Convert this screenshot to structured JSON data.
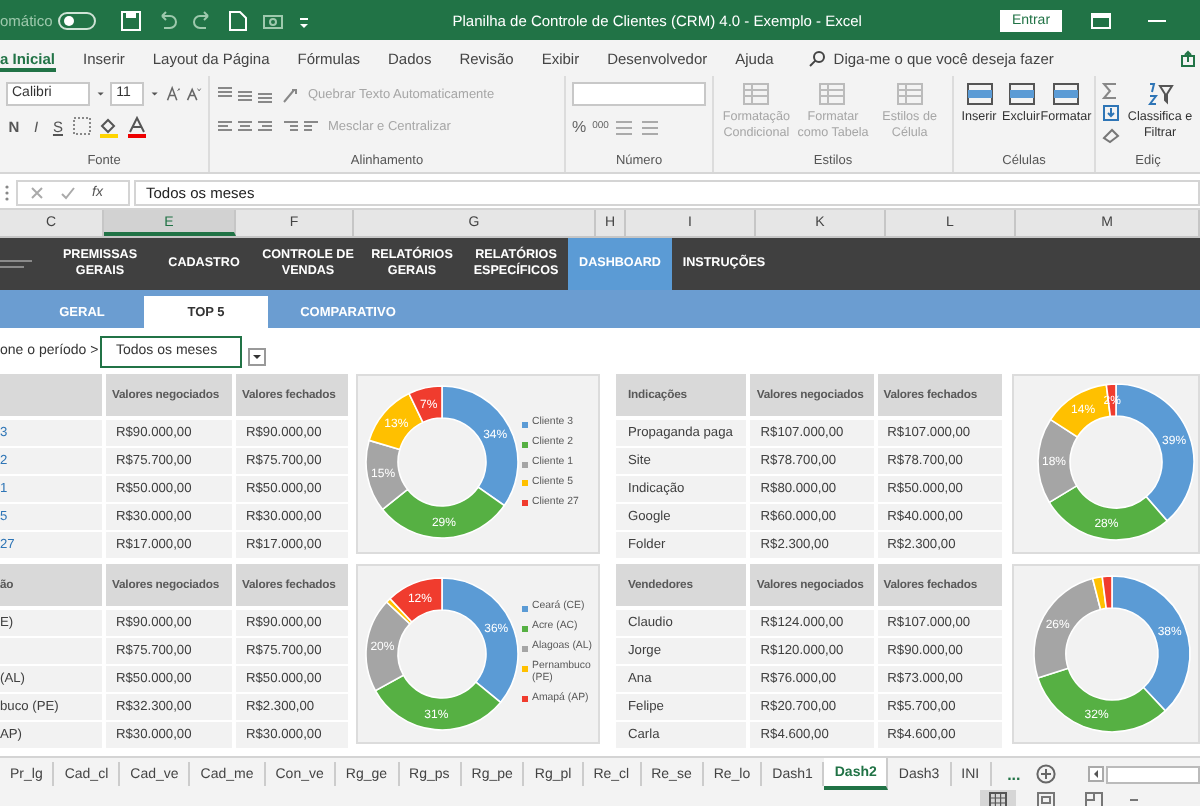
{
  "title_bar": {
    "autosave_label": "omático",
    "autosave_on": false,
    "title": "Planilha de Controle de Clientes (CRM) 4.0 - Exemplo  -  Excel",
    "sign_in": "Entrar"
  },
  "ribbon_tabs": [
    {
      "label": "a Inicial",
      "selected": true
    },
    {
      "label": "Inserir",
      "selected": false
    },
    {
      "label": "Layout da Página",
      "selected": false
    },
    {
      "label": "Fórmulas",
      "selected": false
    },
    {
      "label": "Dados",
      "selected": false
    },
    {
      "label": "Revisão",
      "selected": false
    },
    {
      "label": "Exibir",
      "selected": false
    },
    {
      "label": "Desenvolvedor",
      "selected": false
    },
    {
      "label": "Ajuda",
      "selected": false
    }
  ],
  "tell_me": {
    "placeholder": "Diga-me o que você deseja fazer"
  },
  "ribbon": {
    "font": {
      "name": "Calibri",
      "size": "11",
      "styles": [
        "N",
        "I",
        "S"
      ],
      "label": "Fonte"
    },
    "alignment": {
      "wrap": {
        "label": "Quebrar Texto Automaticamente",
        "disabled": true
      },
      "merge": {
        "label": "Mesclar e Centralizar",
        "disabled": true
      },
      "label": "Alinhamento"
    },
    "number": {
      "percent": "%",
      "thousands": "000",
      "label": "Número"
    },
    "styles": {
      "buttons": [
        {
          "label": "Formatação Condicional",
          "disabled": true
        },
        {
          "label": "Formatar como Tabela",
          "disabled": true
        },
        {
          "label": "Estilos de Célula",
          "disabled": true
        }
      ],
      "label": "Estilos"
    },
    "cells": {
      "buttons": [
        {
          "label": "Inserir",
          "disabled": false
        },
        {
          "label": "Excluir",
          "disabled": false
        },
        {
          "label": "Formatar",
          "disabled": false
        }
      ],
      "label": "Células"
    },
    "editing": {
      "sort": "Classifica e Filtrar",
      "label": "Ediç"
    }
  },
  "formula_bar": {
    "fx": "fx",
    "value": "Todos os meses"
  },
  "columns": [
    {
      "label": "C",
      "selected": false
    },
    {
      "label": "E",
      "selected": true
    },
    {
      "label": "F",
      "selected": false
    },
    {
      "label": "G",
      "selected": false
    },
    {
      "label": "H",
      "selected": false
    },
    {
      "label": "I",
      "selected": false
    },
    {
      "label": "K",
      "selected": false
    },
    {
      "label": "L",
      "selected": false
    },
    {
      "label": "M",
      "selected": false
    }
  ],
  "nav": [
    {
      "label": "PREMISSAS GERAIS",
      "selected": false
    },
    {
      "label": "CADASTRO",
      "selected": false
    },
    {
      "label": "CONTROLE DE VENDAS",
      "selected": false
    },
    {
      "label": "RELATÓRIOS GERAIS",
      "selected": false
    },
    {
      "label": "RELATÓRIOS ESPECÍFICOS",
      "selected": false
    },
    {
      "label": "DASHBOARD",
      "selected": true
    },
    {
      "label": "INSTRUÇÕES",
      "selected": false
    }
  ],
  "sub_tabs": [
    {
      "label": "GERAL",
      "selected": false
    },
    {
      "label": "TOP 5",
      "selected": true
    },
    {
      "label": "COMPARATIVO",
      "selected": false
    }
  ],
  "period": {
    "label": "one o período >",
    "value": "Todos os meses"
  },
  "dashboard": [
    {
      "kind": "table",
      "link_keys": true,
      "columns": [
        "Valores negociados",
        "Valores fechados"
      ],
      "rows": [
        {
          "key": "3",
          "negotiated": "R$90.000,00",
          "closed": "R$90.000,00"
        },
        {
          "key": "2",
          "negotiated": "R$75.700,00",
          "closed": "R$75.700,00"
        },
        {
          "key": "1",
          "negotiated": "R$50.000,00",
          "closed": "R$50.000,00"
        },
        {
          "key": "5",
          "negotiated": "R$30.000,00",
          "closed": "R$30.000,00"
        },
        {
          "key": "27",
          "negotiated": "R$17.000,00",
          "closed": "R$17.000,00"
        }
      ]
    },
    {
      "kind": "chart",
      "chart_data": {
        "type": "donut",
        "legend": "right",
        "categories": [
          "Cliente 3",
          "Cliente 2",
          "Cliente 1",
          "Cliente 5",
          "Cliente 27"
        ],
        "values": [
          34,
          29,
          15,
          13,
          7
        ],
        "value_labels": [
          "34%",
          "29%",
          "15%",
          "13%",
          "7%"
        ]
      }
    },
    {
      "kind": "table",
      "link_keys": false,
      "key_header": "Indicações",
      "columns": [
        "Valores negociados",
        "Valores fechados"
      ],
      "rows": [
        {
          "key": "Propaganda paga",
          "negotiated": "R$107.000,00",
          "closed": "R$107.000,00"
        },
        {
          "key": "Site",
          "negotiated": "R$78.700,00",
          "closed": "R$78.700,00"
        },
        {
          "key": "Indicação",
          "negotiated": "R$80.000,00",
          "closed": "R$50.000,00"
        },
        {
          "key": "Google",
          "negotiated": "R$60.000,00",
          "closed": "R$40.000,00"
        },
        {
          "key": "Folder",
          "negotiated": "R$2.300,00",
          "closed": "R$2.300,00"
        }
      ]
    },
    {
      "kind": "chart",
      "chart_data": {
        "type": "donut",
        "values": [
          39,
          28,
          18,
          14,
          2
        ],
        "value_labels": [
          "39%",
          "28%",
          "18%",
          "14%",
          "2%"
        ]
      }
    },
    {
      "kind": "table",
      "link_keys": false,
      "key_header": "ão",
      "columns": [
        "Valores negociados",
        "Valores fechados"
      ],
      "rows": [
        {
          "key": "E)",
          "negotiated": "R$90.000,00",
          "closed": "R$90.000,00"
        },
        {
          "negotiated": "R$75.700,00",
          "closed": "R$75.700,00"
        },
        {
          "key": "(AL)",
          "negotiated": "R$50.000,00",
          "closed": "R$50.000,00"
        },
        {
          "key": "buco (PE)",
          "negotiated": "R$32.300,00",
          "closed": "R$2.300,00"
        },
        {
          "key": "AP)",
          "negotiated": "R$30.000,00",
          "closed": "R$30.000,00"
        }
      ]
    },
    {
      "kind": "chart",
      "chart_data": {
        "type": "donut",
        "legend": "right",
        "categories": [
          "Ceará (CE)",
          "Acre (AC)",
          "Alagoas (AL)",
          "Pernambuco (PE)",
          "Amapá (AP)"
        ],
        "values": [
          36,
          31,
          20,
          1,
          12
        ],
        "value_labels": [
          "36%",
          "31%",
          "20%",
          null,
          "12%"
        ]
      }
    },
    {
      "kind": "table",
      "link_keys": false,
      "key_header": "Vendedores",
      "columns": [
        "Valores negociados",
        "Valores fechados"
      ],
      "rows": [
        {
          "key": "Claudio",
          "negotiated": "R$124.000,00",
          "closed": "R$107.000,00"
        },
        {
          "key": "Jorge",
          "negotiated": "R$120.000,00",
          "closed": "R$90.000,00"
        },
        {
          "key": "Ana",
          "negotiated": "R$76.000,00",
          "closed": "R$73.000,00"
        },
        {
          "key": "Felipe",
          "negotiated": "R$20.700,00",
          "closed": "R$5.700,00"
        },
        {
          "key": "Carla",
          "negotiated": "R$4.600,00",
          "closed": "R$4.600,00"
        }
      ]
    },
    {
      "kind": "chart",
      "chart_data": {
        "type": "donut",
        "values": [
          38,
          32,
          26,
          2,
          2
        ],
        "value_labels": [
          "38%",
          "32%",
          "26%",
          null,
          null
        ]
      }
    }
  ],
  "sheet_tabs": [
    {
      "label": "Pr_lg",
      "selected": false
    },
    {
      "label": "Cad_cl",
      "selected": false
    },
    {
      "label": "Cad_ve",
      "selected": false
    },
    {
      "label": "Cad_me",
      "selected": false
    },
    {
      "label": "Con_ve",
      "selected": false
    },
    {
      "label": "Rg_ge",
      "selected": false
    },
    {
      "label": "Rg_ps",
      "selected": false
    },
    {
      "label": "Rg_pe",
      "selected": false
    },
    {
      "label": "Rg_pl",
      "selected": false
    },
    {
      "label": "Re_cl",
      "selected": false
    },
    {
      "label": "Re_se",
      "selected": false
    },
    {
      "label": "Re_lo",
      "selected": false
    },
    {
      "label": "Dash1",
      "selected": false
    },
    {
      "label": "Dash2",
      "selected": true
    },
    {
      "label": "Dash3",
      "selected": false
    },
    {
      "label": "INI",
      "selected": false
    }
  ],
  "more_sheets": "..."
}
